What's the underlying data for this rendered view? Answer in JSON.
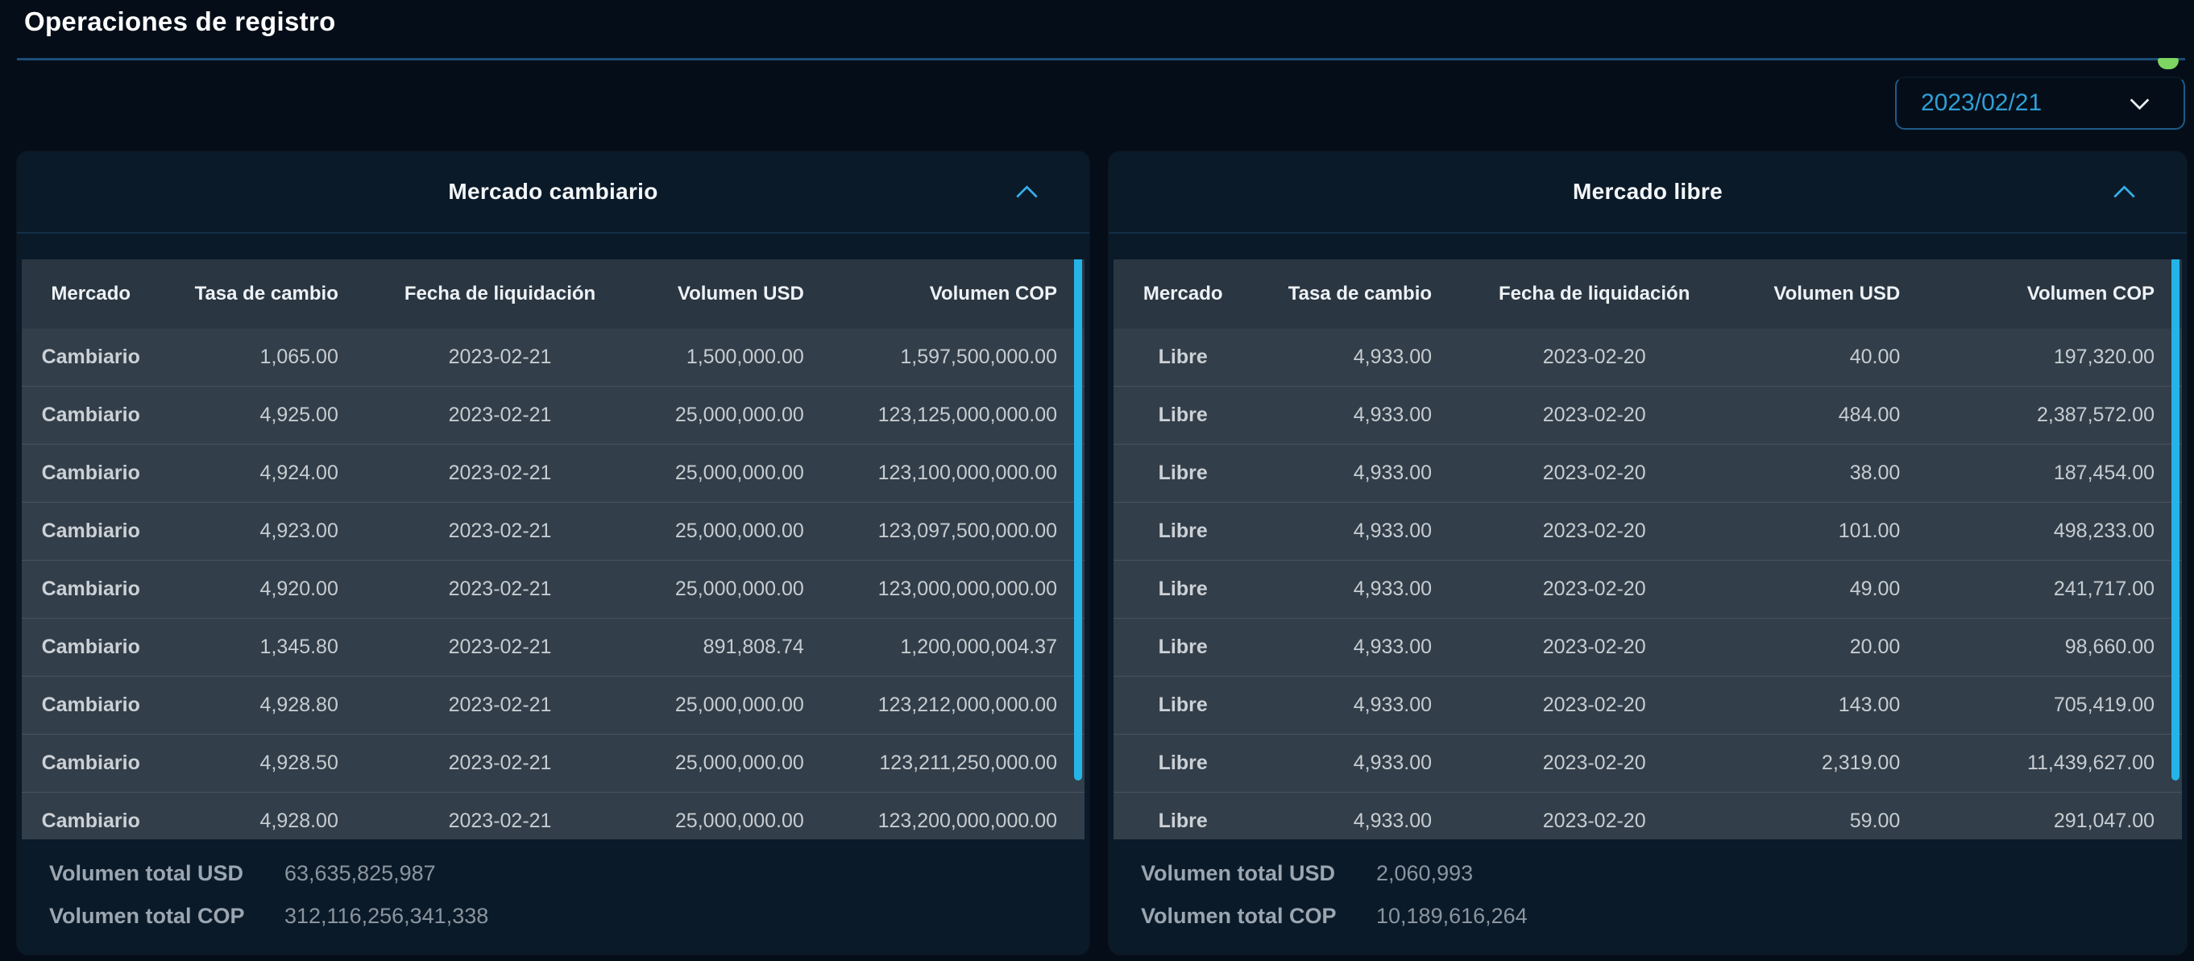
{
  "page": {
    "title": "Operaciones de registro"
  },
  "date_select": {
    "value": "2023/02/21",
    "icon": "chevron-down-icon"
  },
  "indicator": {
    "icon": "green-scroll-indicator",
    "color": "#7ed561"
  },
  "colors": {
    "accent_cyan": "#25b4e8",
    "date_blue": "#2f9fd8",
    "underline_blue": "#1c4d78",
    "card_bg": "#0b1a29",
    "row_bg": "#323e49",
    "header_row_bg": "#2a3641"
  },
  "panels": [
    {
      "title": "Mercado cambiario",
      "collapse_icon": "chevron-up-icon",
      "columns": [
        "Mercado",
        "Tasa de cambio",
        "Fecha de liquidación",
        "Volumen USD",
        "Volumen COP"
      ],
      "rows": [
        [
          "Cambiario",
          "1,065.00",
          "2023-02-21",
          "1,500,000.00",
          "1,597,500,000.00"
        ],
        [
          "Cambiario",
          "4,925.00",
          "2023-02-21",
          "25,000,000.00",
          "123,125,000,000.00"
        ],
        [
          "Cambiario",
          "4,924.00",
          "2023-02-21",
          "25,000,000.00",
          "123,100,000,000.00"
        ],
        [
          "Cambiario",
          "4,923.00",
          "2023-02-21",
          "25,000,000.00",
          "123,097,500,000.00"
        ],
        [
          "Cambiario",
          "4,920.00",
          "2023-02-21",
          "25,000,000.00",
          "123,000,000,000.00"
        ],
        [
          "Cambiario",
          "1,345.80",
          "2023-02-21",
          "891,808.74",
          "1,200,000,004.37"
        ],
        [
          "Cambiario",
          "4,928.80",
          "2023-02-21",
          "25,000,000.00",
          "123,212,000,000.00"
        ],
        [
          "Cambiario",
          "4,928.50",
          "2023-02-21",
          "25,000,000.00",
          "123,211,250,000.00"
        ],
        [
          "Cambiario",
          "4,928.00",
          "2023-02-21",
          "25,000,000.00",
          "123,200,000,000.00"
        ]
      ],
      "totals": {
        "usd_label": "Volumen total USD",
        "usd_value": "63,635,825,987",
        "cop_label": "Volumen total COP",
        "cop_value": "312,116,256,341,338"
      }
    },
    {
      "title": "Mercado libre",
      "collapse_icon": "chevron-up-icon",
      "columns": [
        "Mercado",
        "Tasa de cambio",
        "Fecha de liquidación",
        "Volumen USD",
        "Volumen COP"
      ],
      "rows": [
        [
          "Libre",
          "4,933.00",
          "2023-02-20",
          "40.00",
          "197,320.00"
        ],
        [
          "Libre",
          "4,933.00",
          "2023-02-20",
          "484.00",
          "2,387,572.00"
        ],
        [
          "Libre",
          "4,933.00",
          "2023-02-20",
          "38.00",
          "187,454.00"
        ],
        [
          "Libre",
          "4,933.00",
          "2023-02-20",
          "101.00",
          "498,233.00"
        ],
        [
          "Libre",
          "4,933.00",
          "2023-02-20",
          "49.00",
          "241,717.00"
        ],
        [
          "Libre",
          "4,933.00",
          "2023-02-20",
          "20.00",
          "98,660.00"
        ],
        [
          "Libre",
          "4,933.00",
          "2023-02-20",
          "143.00",
          "705,419.00"
        ],
        [
          "Libre",
          "4,933.00",
          "2023-02-20",
          "2,319.00",
          "11,439,627.00"
        ],
        [
          "Libre",
          "4,933.00",
          "2023-02-20",
          "59.00",
          "291,047.00"
        ]
      ],
      "totals": {
        "usd_label": "Volumen total USD",
        "usd_value": "2,060,993",
        "cop_label": "Volumen total COP",
        "cop_value": "10,189,616,264"
      }
    }
  ]
}
